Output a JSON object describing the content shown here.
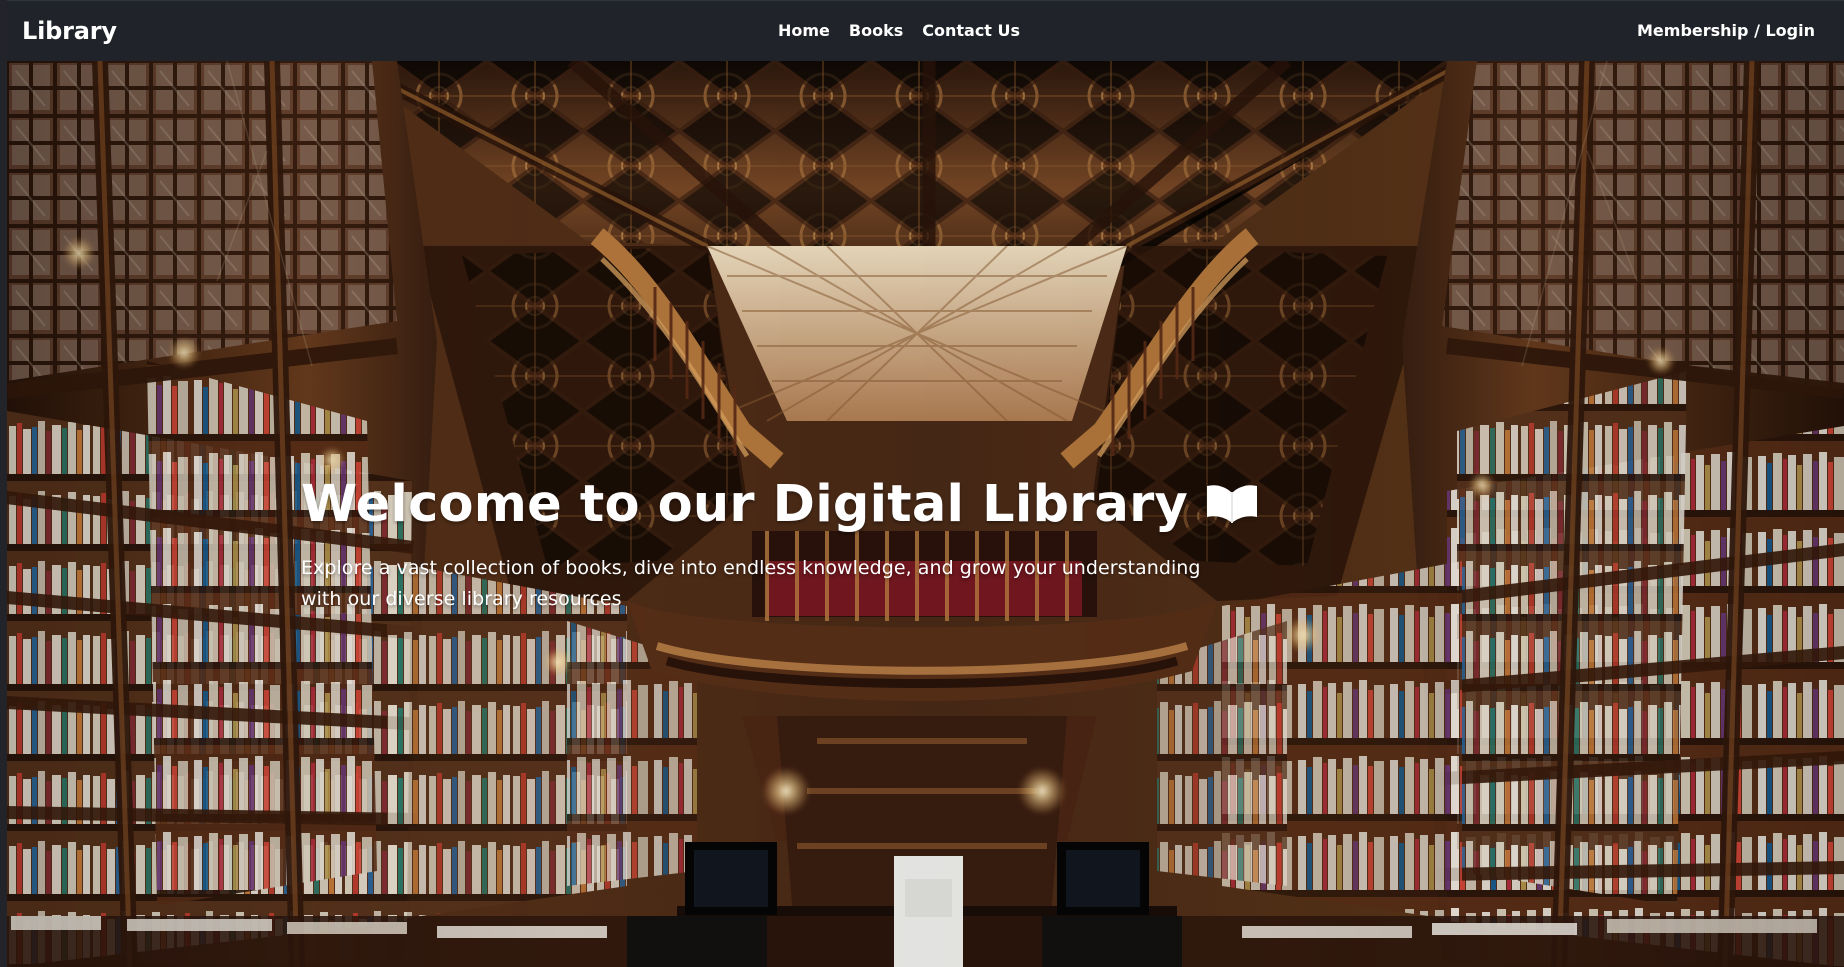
{
  "navbar": {
    "brand": "Library",
    "links": [
      {
        "label": "Home"
      },
      {
        "label": "Books"
      },
      {
        "label": "Contact Us"
      }
    ],
    "membership_label": "Membership / Login"
  },
  "hero": {
    "title": "Welcome to our Digital Library",
    "description": "Explore a vast collection of books, dive into endless knowledge, and grow your understanding with our diverse library resources",
    "title_icon": "open-book-icon",
    "background": "library-interior-photo"
  },
  "colors": {
    "navbar": "#20242a",
    "text": "#ffffff",
    "wood_dark": "#2a160d",
    "wood_mid": "#7a4a25",
    "ceiling_light": "#e9d2b4"
  }
}
